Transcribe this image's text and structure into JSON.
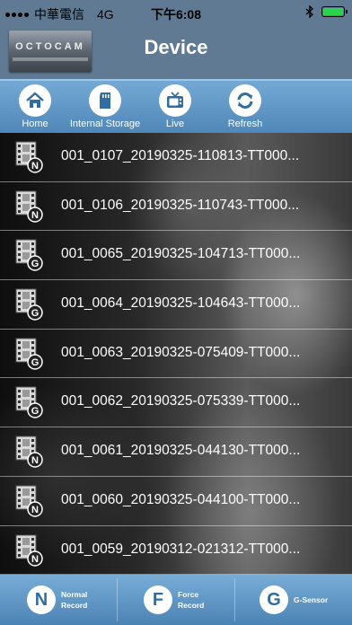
{
  "status_bar": {
    "carrier": "中華電信",
    "network": "4G",
    "time": "下午6:08",
    "battery_color": "#2bd24b"
  },
  "header": {
    "logo_text": "OCTOCAM",
    "title": "Device",
    "background": "#5f7a92"
  },
  "toolbar": {
    "items": [
      {
        "label": "Home",
        "icon": "home-icon"
      },
      {
        "label": "Internal Storage",
        "icon": "sd-card-icon"
      },
      {
        "label": "Live",
        "icon": "tv-icon"
      },
      {
        "label": "Refresh",
        "icon": "refresh-icon"
      }
    ]
  },
  "files": [
    {
      "name": "001_0107_20190325-110813-TT000...",
      "type": "N"
    },
    {
      "name": "001_0106_20190325-110743-TT000...",
      "type": "N"
    },
    {
      "name": "001_0065_20190325-104713-TT000...",
      "type": "G"
    },
    {
      "name": "001_0064_20190325-104643-TT000...",
      "type": "G"
    },
    {
      "name": "001_0063_20190325-075409-TT000...",
      "type": "G"
    },
    {
      "name": "001_0062_20190325-075339-TT000...",
      "type": "G"
    },
    {
      "name": "001_0061_20190325-044130-TT000...",
      "type": "N"
    },
    {
      "name": "001_0060_20190325-044100-TT000...",
      "type": "N"
    },
    {
      "name": "001_0059_20190312-021312-TT000...",
      "type": "N"
    }
  ],
  "bottom_bar": {
    "items": [
      {
        "letter": "N",
        "line1": "Normal",
        "line2": "Record"
      },
      {
        "letter": "F",
        "line1": "Force",
        "line2": "Record"
      },
      {
        "letter": "G",
        "line1": "G-Sensor",
        "line2": ""
      }
    ]
  }
}
